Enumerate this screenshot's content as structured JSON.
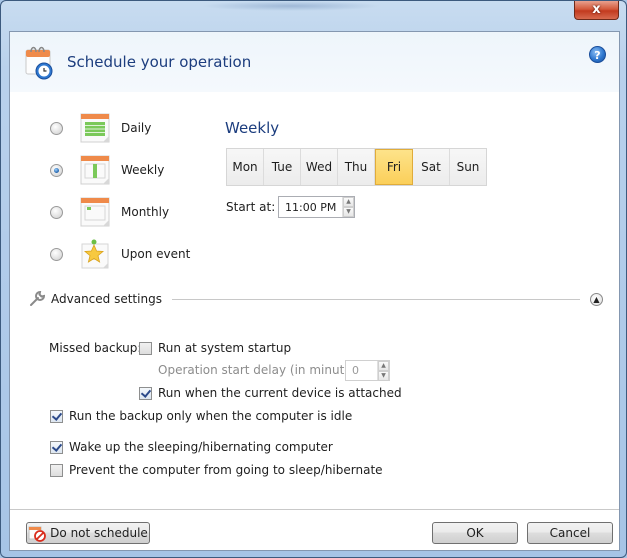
{
  "window": {
    "close_label": "x"
  },
  "header": {
    "title": "Schedule your operation",
    "help_label": "?"
  },
  "schedule_types": [
    {
      "label": "Daily",
      "selected": false,
      "icon": "calendar-daily-icon"
    },
    {
      "label": "Weekly",
      "selected": true,
      "icon": "calendar-weekly-icon"
    },
    {
      "label": "Monthly",
      "selected": false,
      "icon": "calendar-monthly-icon"
    },
    {
      "label": "Upon event",
      "selected": false,
      "icon": "star-event-icon"
    }
  ],
  "weekly": {
    "title": "Weekly",
    "days": [
      {
        "label": "Mon",
        "selected": false
      },
      {
        "label": "Tue",
        "selected": false
      },
      {
        "label": "Wed",
        "selected": false
      },
      {
        "label": "Thu",
        "selected": false
      },
      {
        "label": "Fri",
        "selected": true
      },
      {
        "label": "Sat",
        "selected": false
      },
      {
        "label": "Sun",
        "selected": false
      }
    ],
    "start_at_label": "Start at:",
    "start_at_value": "11:00 PM"
  },
  "advanced": {
    "label": "Advanced settings",
    "collapse_glyph": "▲",
    "missed_backup_label": "Missed backup:",
    "run_at_startup": {
      "label": "Run at system startup",
      "checked": false
    },
    "start_delay_label": "Operation start delay (in minutes):",
    "start_delay_value": "0",
    "run_when_attached": {
      "label": "Run when the current device is attached",
      "checked": true
    },
    "run_when_idle": {
      "label": "Run the backup only when the computer is idle",
      "checked": true
    },
    "wake_up": {
      "label": "Wake up the sleeping/hibernating computer",
      "checked": true
    },
    "prevent_sleep": {
      "label": "Prevent the computer from going to sleep/hibernate",
      "checked": false
    }
  },
  "footer": {
    "do_not_schedule": "Do not schedule",
    "ok": "OK",
    "cancel": "Cancel"
  },
  "colors": {
    "accent_title": "#1c3d7e",
    "selected_day": "#fbcf5a"
  }
}
